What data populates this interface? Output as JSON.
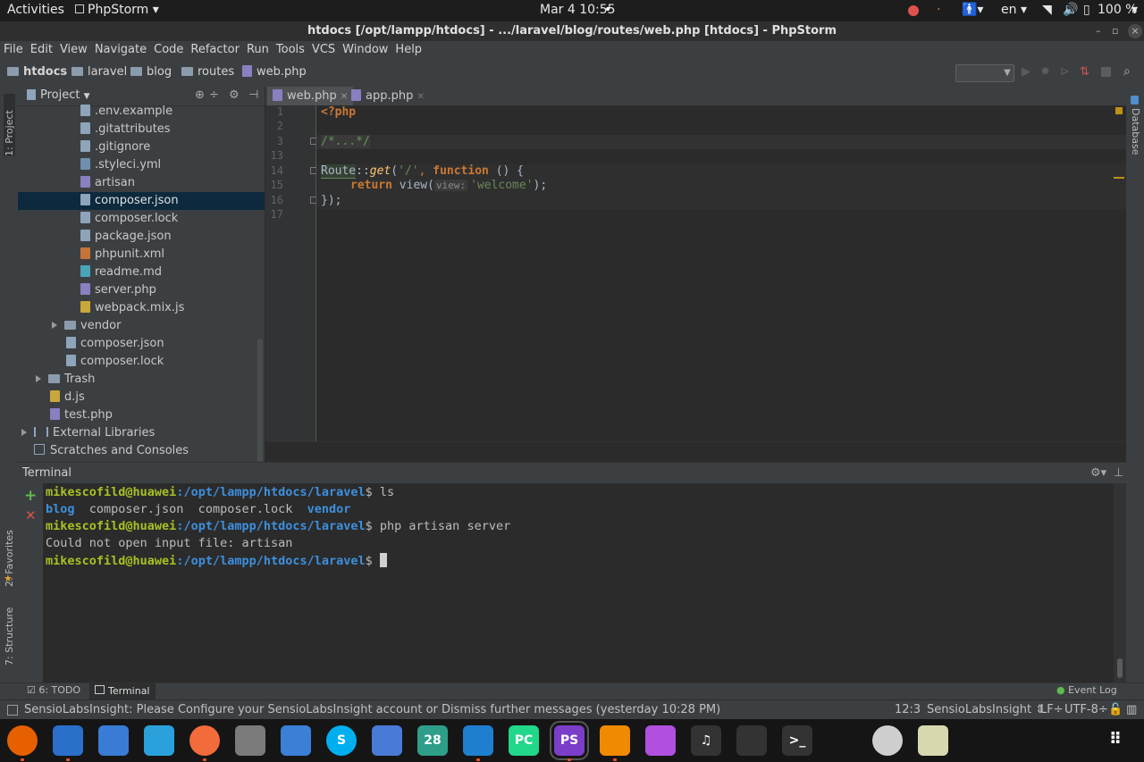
{
  "topbar": {
    "activities": "Activities",
    "app_name": "PhpStorm",
    "clock": "Mar 4  10:55",
    "lang": "en",
    "battery": "100 %"
  },
  "window": {
    "title": "htdocs [/opt/lampp/htdocs] - .../laravel/blog/routes/web.php [htdocs] - PhpStorm"
  },
  "menu": [
    "File",
    "Edit",
    "View",
    "Navigate",
    "Code",
    "Refactor",
    "Run",
    "Tools",
    "VCS",
    "Window",
    "Help"
  ],
  "breadcrumbs": [
    "htdocs",
    "laravel",
    "blog",
    "routes",
    "web.php"
  ],
  "project_panel": {
    "title": "Project",
    "items": [
      {
        "label": ".env.example"
      },
      {
        "label": ".gitattributes"
      },
      {
        "label": ".gitignore"
      },
      {
        "label": ".styleci.yml"
      },
      {
        "label": "artisan"
      },
      {
        "label": "composer.json"
      },
      {
        "label": "composer.lock"
      },
      {
        "label": "package.json"
      },
      {
        "label": "phpunit.xml"
      },
      {
        "label": "readme.md"
      },
      {
        "label": "server.php"
      },
      {
        "label": "webpack.mix.js"
      },
      {
        "label": "vendor"
      },
      {
        "label": "composer.json"
      },
      {
        "label": "composer.lock"
      },
      {
        "label": "Trash"
      },
      {
        "label": "d.js"
      },
      {
        "label": "test.php"
      },
      {
        "label": "External Libraries"
      },
      {
        "label": "Scratches and Consoles"
      }
    ]
  },
  "editor": {
    "tabs": [
      {
        "label": "web.php"
      },
      {
        "label": "app.php"
      }
    ],
    "line_numbers": [
      "1",
      "2",
      "3",
      "13",
      "14",
      "15",
      "16",
      "17"
    ],
    "code": {
      "l1": "<?php",
      "l3": "/*...*/",
      "l14_route": "Route",
      "l14_sep": "::",
      "l14_get": "get",
      "l14_open": "(",
      "l14_str": "'/'",
      "l14_comma": ", ",
      "l14_function": "function",
      "l14_rest": " () {",
      "l15_return": "return",
      "l15_view": " view(",
      "l15_hint": "view:",
      "l15_str": "'welcome'",
      "l15_end": ");",
      "l16": "});"
    }
  },
  "terminal": {
    "title": "Terminal",
    "user": "mikescofild@huawei",
    "path": ":/opt/lampp/htdocs/laravel",
    "prompt_sign": "$ ",
    "cmd1": "ls",
    "ls_blog": "blog",
    "ls_files": "  composer.json  composer.lock  ",
    "ls_vendor": "vendor",
    "cmd2": "php artisan server",
    "error": "Could not open input file: artisan"
  },
  "side_labels": {
    "project": "1: Project",
    "favorites": "2: Favorites",
    "structure": "7: Structure",
    "database": "Database"
  },
  "bottom_tools": {
    "todo": "6: TODO",
    "terminal": "Terminal",
    "event_log": "Event Log"
  },
  "status": {
    "message": "SensioLabsInsight: Please Configure your SensioLabsInsight account or Dismiss further messages (yesterday 10:28 PM)",
    "position": "12:3",
    "plugin": "SensioLabsInsight",
    "line_sep": "LF",
    "encoding": "UTF-8"
  },
  "dock": [
    {
      "name": "firefox-icon",
      "color": "#e66000",
      "text": ""
    },
    {
      "name": "thunderbird-icon",
      "color": "#2a6fc9",
      "text": ""
    },
    {
      "name": "files-icon",
      "color": "#3a7bd5",
      "text": ""
    },
    {
      "name": "telegram-icon",
      "color": "#2aa1da",
      "text": ""
    },
    {
      "name": "postman-icon",
      "color": "#f26b3a",
      "text": ""
    },
    {
      "name": "settings-icon",
      "color": "#7a7a7a",
      "text": ""
    },
    {
      "name": "simplenote-icon",
      "color": "#3b7fd6",
      "text": ""
    },
    {
      "name": "skype-icon",
      "color": "#00aff0",
      "text": "S"
    },
    {
      "name": "tasks-icon",
      "color": "#4a7ad8",
      "text": ""
    },
    {
      "name": "calendar-icon",
      "color": "#2e9e8a",
      "text": "28"
    },
    {
      "name": "vscode-icon",
      "color": "#1e7fd0",
      "text": ""
    },
    {
      "name": "pycharm-icon",
      "color": "#21d789",
      "text": "PC"
    },
    {
      "name": "phpstorm-icon",
      "color": "#7a3ec9",
      "text": "PS"
    },
    {
      "name": "vlc-icon",
      "color": "#f08a00",
      "text": ""
    },
    {
      "name": "kite-icon",
      "color": "#b04fe0",
      "text": ""
    },
    {
      "name": "music-icon",
      "color": "#333333",
      "text": "♫"
    },
    {
      "name": "system-monitor-icon",
      "color": "#333333",
      "text": ""
    },
    {
      "name": "terminal-icon",
      "color": "#333333",
      "text": ">_"
    },
    {
      "name": "help-icon",
      "color": "#cfcfcf",
      "text": ""
    },
    {
      "name": "notes-icon",
      "color": "#d8d8b0",
      "text": ""
    }
  ]
}
